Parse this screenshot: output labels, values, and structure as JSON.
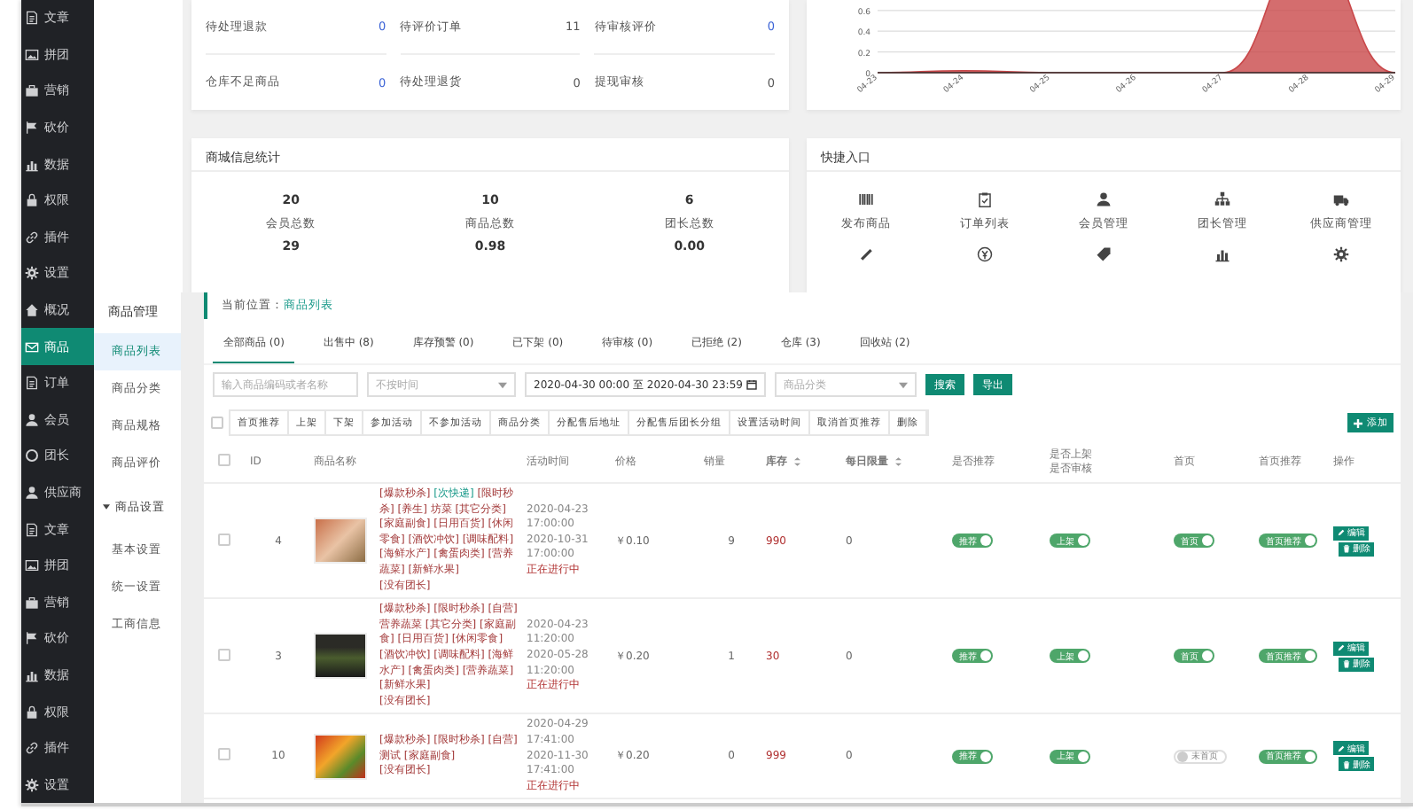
{
  "nav": [
    {
      "label": "文章",
      "selected": false
    },
    {
      "label": "拼团",
      "selected": false
    },
    {
      "label": "营销",
      "selected": false
    },
    {
      "label": "砍价",
      "selected": false
    },
    {
      "label": "数据",
      "selected": false
    },
    {
      "label": "权限",
      "selected": false
    },
    {
      "label": "插件",
      "selected": false
    },
    {
      "label": "设置",
      "selected": false
    },
    {
      "label": "概况",
      "selected": false
    },
    {
      "label": "商品",
      "selected": true
    },
    {
      "label": "订单",
      "selected": false
    },
    {
      "label": "会员",
      "selected": false
    },
    {
      "label": "团长",
      "selected": false
    },
    {
      "label": "供应商",
      "selected": false
    },
    {
      "label": "文章",
      "selected": false
    },
    {
      "label": "拼团",
      "selected": false
    },
    {
      "label": "营销",
      "selected": false
    },
    {
      "label": "砍价",
      "selected": false
    },
    {
      "label": "数据",
      "selected": false
    },
    {
      "label": "权限",
      "selected": false
    },
    {
      "label": "插件",
      "selected": false
    },
    {
      "label": "设置",
      "selected": false
    }
  ],
  "subnav": {
    "title": "商品管理",
    "items": [
      {
        "label": "商品列表",
        "selected": true
      },
      {
        "label": "商品分类",
        "selected": false
      },
      {
        "label": "商品规格",
        "selected": false
      },
      {
        "label": "商品评价",
        "selected": false
      }
    ],
    "group": {
      "label": "商品设置",
      "expanded": true,
      "items": [
        {
          "label": "基本设置",
          "selected": false
        },
        {
          "label": "统一设置",
          "selected": false
        },
        {
          "label": "工商信息",
          "selected": false
        }
      ]
    }
  },
  "todo": [
    {
      "label": "待处理退款",
      "value": "0",
      "highlight": true
    },
    {
      "label": "待评价订单",
      "value": "11",
      "highlight": false
    },
    {
      "label": "待审核评价",
      "value": "0",
      "highlight": true
    },
    {
      "label": "仓库不足商品",
      "value": "0",
      "highlight": true
    },
    {
      "label": "待处理退货",
      "value": "0",
      "highlight": false
    },
    {
      "label": "提现审核",
      "value": "0",
      "highlight": false
    }
  ],
  "sales_chart": {
    "y_labels": [
      "0.6",
      "0.4",
      "0.2",
      "0"
    ],
    "x_labels": [
      "04-23",
      "04-24",
      "04-25",
      "04-26",
      "04-27",
      "04-28",
      "04-29"
    ]
  },
  "mall_stats": {
    "title": "商城信息统计",
    "items": [
      {
        "value": "20",
        "label": "会员总数"
      },
      {
        "value": "10",
        "label": "商品总数"
      },
      {
        "value": "6",
        "label": "团长总数"
      },
      {
        "value": "29"
      },
      {
        "value": "0.98"
      },
      {
        "value": "0.00"
      }
    ]
  },
  "shortcuts": {
    "title": "快捷入口",
    "items": [
      {
        "label": "发布商品"
      },
      {
        "label": "订单列表"
      },
      {
        "label": "会员管理"
      },
      {
        "label": "团长管理"
      },
      {
        "label": "供应商管理"
      }
    ]
  },
  "goods": {
    "breadcrumb": {
      "label": "当前位置：",
      "link": "商品列表"
    },
    "tabs": [
      {
        "label": "全部商品 (0)",
        "selected": true
      },
      {
        "label": "出售中 (8)",
        "selected": false
      },
      {
        "label": "库存预警 (0)",
        "selected": false
      },
      {
        "label": "已下架 (0)",
        "selected": false
      },
      {
        "label": "待审核 (0)",
        "selected": false
      },
      {
        "label": "已拒绝 (2)",
        "selected": false
      },
      {
        "label": "仓库 (3)",
        "selected": false
      },
      {
        "label": "回收站 (2)",
        "selected": false
      }
    ],
    "filters": {
      "search_placeholder": "输入商品编码或者名称",
      "time_placeholder": "不按时间",
      "date_range": "2020-04-30 00:00 至 2020-04-30 23:59",
      "category_placeholder": "商品分类",
      "buttons": [
        "搜索",
        "导出"
      ]
    },
    "bulk_actions": [
      "首页推荐",
      "上架",
      "下架",
      "参加活动",
      "不参加活动",
      "商品分类",
      "分配售后地址",
      "分配售后团长分组",
      "设置活动时间",
      "取消首页推荐",
      "删除"
    ],
    "add_button": "添加",
    "select_all_checked": false,
    "columns": [
      {
        "label": "ID",
        "sortable": false
      },
      {
        "label": "商品名称",
        "sortable": false
      },
      {
        "label": "活动时间",
        "sortable": false
      },
      {
        "label": "价格",
        "sortable": false
      },
      {
        "label": "销量",
        "sortable": false
      },
      {
        "label": "库存",
        "sortable": true
      },
      {
        "label": "每日限量",
        "sortable": true
      },
      {
        "label": "是否推荐",
        "sortable": false
      },
      {
        "label": "是否上架是否审核",
        "sortable": false
      },
      {
        "label": "首页",
        "sortable": false
      },
      {
        "label": "首页推荐",
        "sortable": false
      },
      {
        "label": "操作",
        "sortable": false
      }
    ],
    "rows": [
      {
        "checked": false,
        "id": "4",
        "tags": [
          {
            "text": "[爆款秒杀]",
            "highlight": false
          },
          {
            "text": "[次快递]",
            "highlight": true
          },
          {
            "text": "[限时秒杀]",
            "highlight": false
          },
          {
            "text": "[养生]",
            "highlight": false
          },
          {
            "text": "坊菜",
            "highlight": false
          },
          {
            "text": "[其它分类]",
            "highlight": false
          },
          {
            "text": "[家庭副食]",
            "highlight": false
          },
          {
            "text": "[日用百货]",
            "highlight": false
          },
          {
            "text": "[休闲零食]",
            "highlight": false
          },
          {
            "text": "[酒饮冲饮]",
            "highlight": false
          },
          {
            "text": "[调味配料]",
            "highlight": false
          },
          {
            "text": "[海鲜水产]",
            "highlight": false
          },
          {
            "text": "[禽蛋肉类]",
            "highlight": false
          },
          {
            "text": "[营养蔬菜]",
            "highlight": false
          },
          {
            "text": "[新鲜水果]",
            "highlight": false
          }
        ],
        "note": "[没有团长]",
        "start": "2020-04-23 17:00:00",
        "end": "2020-10-31 17:00:00",
        "status": "正在进行中",
        "price": "￥0.10",
        "sales": "9",
        "stock": "990",
        "daily_limit": "0",
        "toggles": [
          {
            "label": "推荐",
            "on": true
          },
          {
            "label": "上架",
            "on": true
          },
          {
            "label": "首页",
            "on": true
          },
          {
            "label": "首页推荐",
            "on": true
          }
        ],
        "actions": [
          "编辑",
          "删除"
        ]
      },
      {
        "checked": false,
        "id": "3",
        "tags": [
          {
            "text": "[爆款秒杀]",
            "highlight": false
          },
          {
            "text": "[限时秒杀]",
            "highlight": false
          },
          {
            "text": "[自营]",
            "highlight": false
          },
          {
            "text": "营养蔬菜",
            "highlight": false
          },
          {
            "text": "[其它分类]",
            "highlight": false
          },
          {
            "text": "[家庭副食]",
            "highlight": false
          },
          {
            "text": "[日用百货]",
            "highlight": false
          },
          {
            "text": "[休闲零食]",
            "highlight": false
          },
          {
            "text": "[酒饮冲饮]",
            "highlight": false
          },
          {
            "text": "[调味配料]",
            "highlight": false
          },
          {
            "text": "[海鲜水产]",
            "highlight": false
          },
          {
            "text": "[禽蛋肉类]",
            "highlight": false
          },
          {
            "text": "[营养蔬菜]",
            "highlight": false
          },
          {
            "text": "[新鲜水果]",
            "highlight": false
          }
        ],
        "note": "[没有团长]",
        "start": "2020-04-23 11:20:00",
        "end": "2020-05-28 11:20:00",
        "status": "正在进行中",
        "price": "￥0.20",
        "sales": "1",
        "stock": "30",
        "daily_limit": "0",
        "toggles": [
          {
            "label": "推荐",
            "on": true
          },
          {
            "label": "上架",
            "on": true
          },
          {
            "label": "首页",
            "on": true
          },
          {
            "label": "首页推荐",
            "on": true
          }
        ],
        "actions": [
          "编辑",
          "删除"
        ]
      },
      {
        "checked": false,
        "id": "10",
        "tags": [
          {
            "text": "[爆款秒杀]",
            "highlight": false
          },
          {
            "text": "[限时秒杀]",
            "highlight": false
          },
          {
            "text": "[自营]",
            "highlight": false
          },
          {
            "text": "测试",
            "highlight": false
          },
          {
            "text": "[家庭副食]",
            "highlight": false
          }
        ],
        "note": "[没有团长]",
        "start": "2020-04-29 17:41:00",
        "end": "2020-11-30 17:41:00",
        "status": "正在进行中",
        "price": "￥0.20",
        "sales": "0",
        "stock": "999",
        "daily_limit": "0",
        "toggles": [
          {
            "label": "推荐",
            "on": true
          },
          {
            "label": "上架",
            "on": true
          },
          {
            "label": "未首页",
            "on": false
          },
          {
            "label": "首页推荐",
            "on": true
          }
        ],
        "actions": [
          "编辑",
          "删除"
        ]
      }
    ]
  }
}
